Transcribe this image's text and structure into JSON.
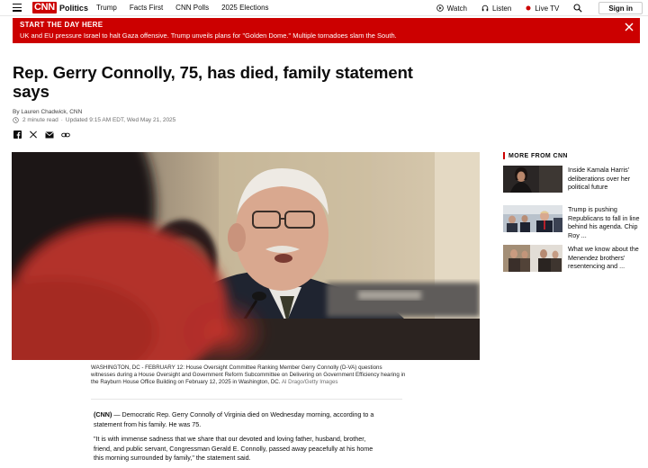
{
  "nav": {
    "logo": "CNN",
    "section": "Politics",
    "links": [
      "Trump",
      "Facts First",
      "CNN Polls",
      "2025 Elections"
    ],
    "watch": "Watch",
    "listen": "Listen",
    "live": "Live TV",
    "signin": "Sign in"
  },
  "banner": {
    "title": "START THE DAY HERE",
    "text": "UK and EU pressure Israel to halt Gaza offensive. Trump unveils plans for \"Golden Dome.\" Multiple tornadoes slam the South.",
    "color": "#cc0000"
  },
  "article": {
    "headline": "Rep. Gerry Connolly, 75, has died, family statement says",
    "byline_prefix": "By",
    "author": "Lauren Chadwick, CNN",
    "read_time": "2 minute read",
    "updated": "Updated 9:15 AM EDT, Wed May 21, 2025",
    "caption": "WASHINGTON, DC - FEBRUARY 12: House Oversight Committee Ranking Member Gerry Connolly (D-VA) questions witnesses during a House Oversight and Government Reform Subcommittee on Delivering on Government Efficiency hearing in the Rayburn House Office Building on February 12, 2025 in Washington, DC.",
    "credit": "Al Drago/Getty Images",
    "dateline": "(CNN)",
    "p1": " — Democratic Rep. Gerry Connolly of Virginia died on Wednesday morning, according to a statement from his family. He was 75.",
    "p2": "\"It is with immense sadness that we share that our devoted and loving father, husband, brother, friend, and public servant, Congressman Gerald E. Connolly, passed away peacefully at his home this morning surrounded by family,\" the statement said."
  },
  "rail": {
    "title": "MORE FROM CNN",
    "items": [
      {
        "text": "Inside Kamala Harris' deliberations over her political future"
      },
      {
        "text": "Trump is pushing Republicans to fall in line behind his agenda. Chip Roy ..."
      },
      {
        "text": "What we know about the Menendez brothers' resentencing and ..."
      }
    ]
  }
}
